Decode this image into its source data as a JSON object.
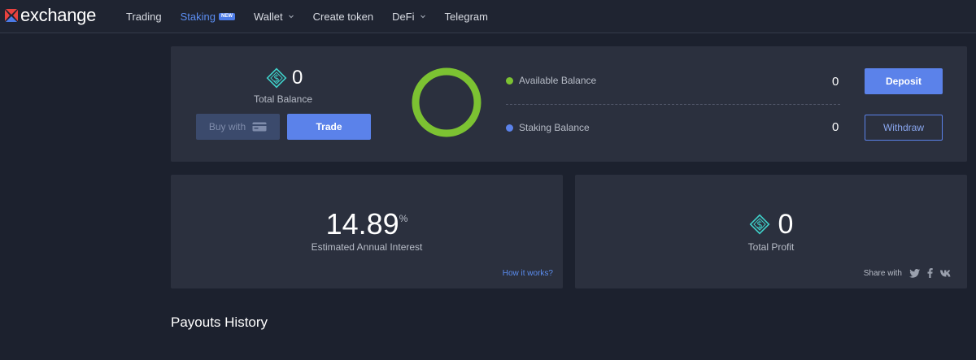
{
  "app": {
    "logo_text": "exchange"
  },
  "nav": {
    "items": [
      {
        "label": "Trading"
      },
      {
        "label": "Staking",
        "badge": "NEW"
      },
      {
        "label": "Wallet"
      },
      {
        "label": "Create token"
      },
      {
        "label": "DeFi"
      },
      {
        "label": "Telegram"
      }
    ]
  },
  "balance": {
    "total_value": "0",
    "total_label": "Total Balance",
    "buy_label": "Buy with",
    "trade_label": "Trade",
    "available_label": "Available Balance",
    "available_value": "0",
    "staking_label": "Staking Balance",
    "staking_value": "0",
    "deposit_label": "Deposit",
    "withdraw_label": "Withdraw"
  },
  "interest": {
    "value_int": "14",
    "value_dec": ".89",
    "unit": "%",
    "label": "Estimated Annual Interest",
    "link": "How it works?"
  },
  "profit": {
    "value": "0",
    "label": "Total Profit",
    "share_label": "Share with",
    "share_icons": [
      "twitter-icon",
      "facebook-icon",
      "vk-icon"
    ]
  },
  "payouts": {
    "title": "Payouts History"
  },
  "colors": {
    "accent": "#5b82ea",
    "available_dot": "#7cc232",
    "staking_dot": "#5b82ea",
    "ring": "#7cc232",
    "coin": "#3fd0c9"
  }
}
